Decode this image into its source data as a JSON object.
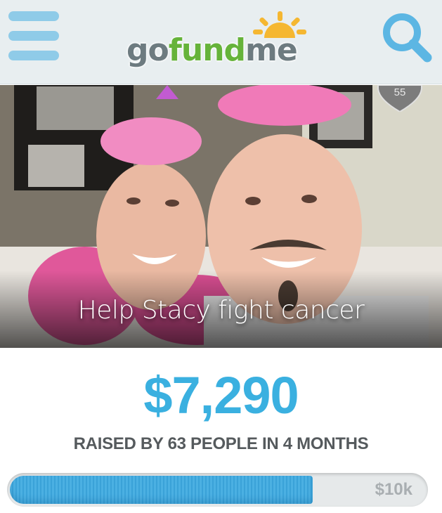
{
  "header": {
    "logo_parts": {
      "go": "go",
      "fund": "fund",
      "me": "me"
    },
    "menu_icon": "hamburger-menu-icon",
    "search_icon": "search-icon",
    "colors": {
      "background": "#e8eef0",
      "icon": "#8fcbe8",
      "logo_green": "#66b33a",
      "logo_gray": "#6d7b80",
      "sun": "#f5b731"
    }
  },
  "campaign": {
    "title": "Help Stacy fight cancer",
    "heart_count": "55",
    "amount_raised": "$7,290",
    "raised_summary": "RAISED BY 63 PEOPLE IN 4 MONTHS",
    "goal_label": "$10k",
    "progress_fraction": 0.729,
    "colors": {
      "amount": "#3ab0e0",
      "progress": "#4bb0e2"
    }
  }
}
